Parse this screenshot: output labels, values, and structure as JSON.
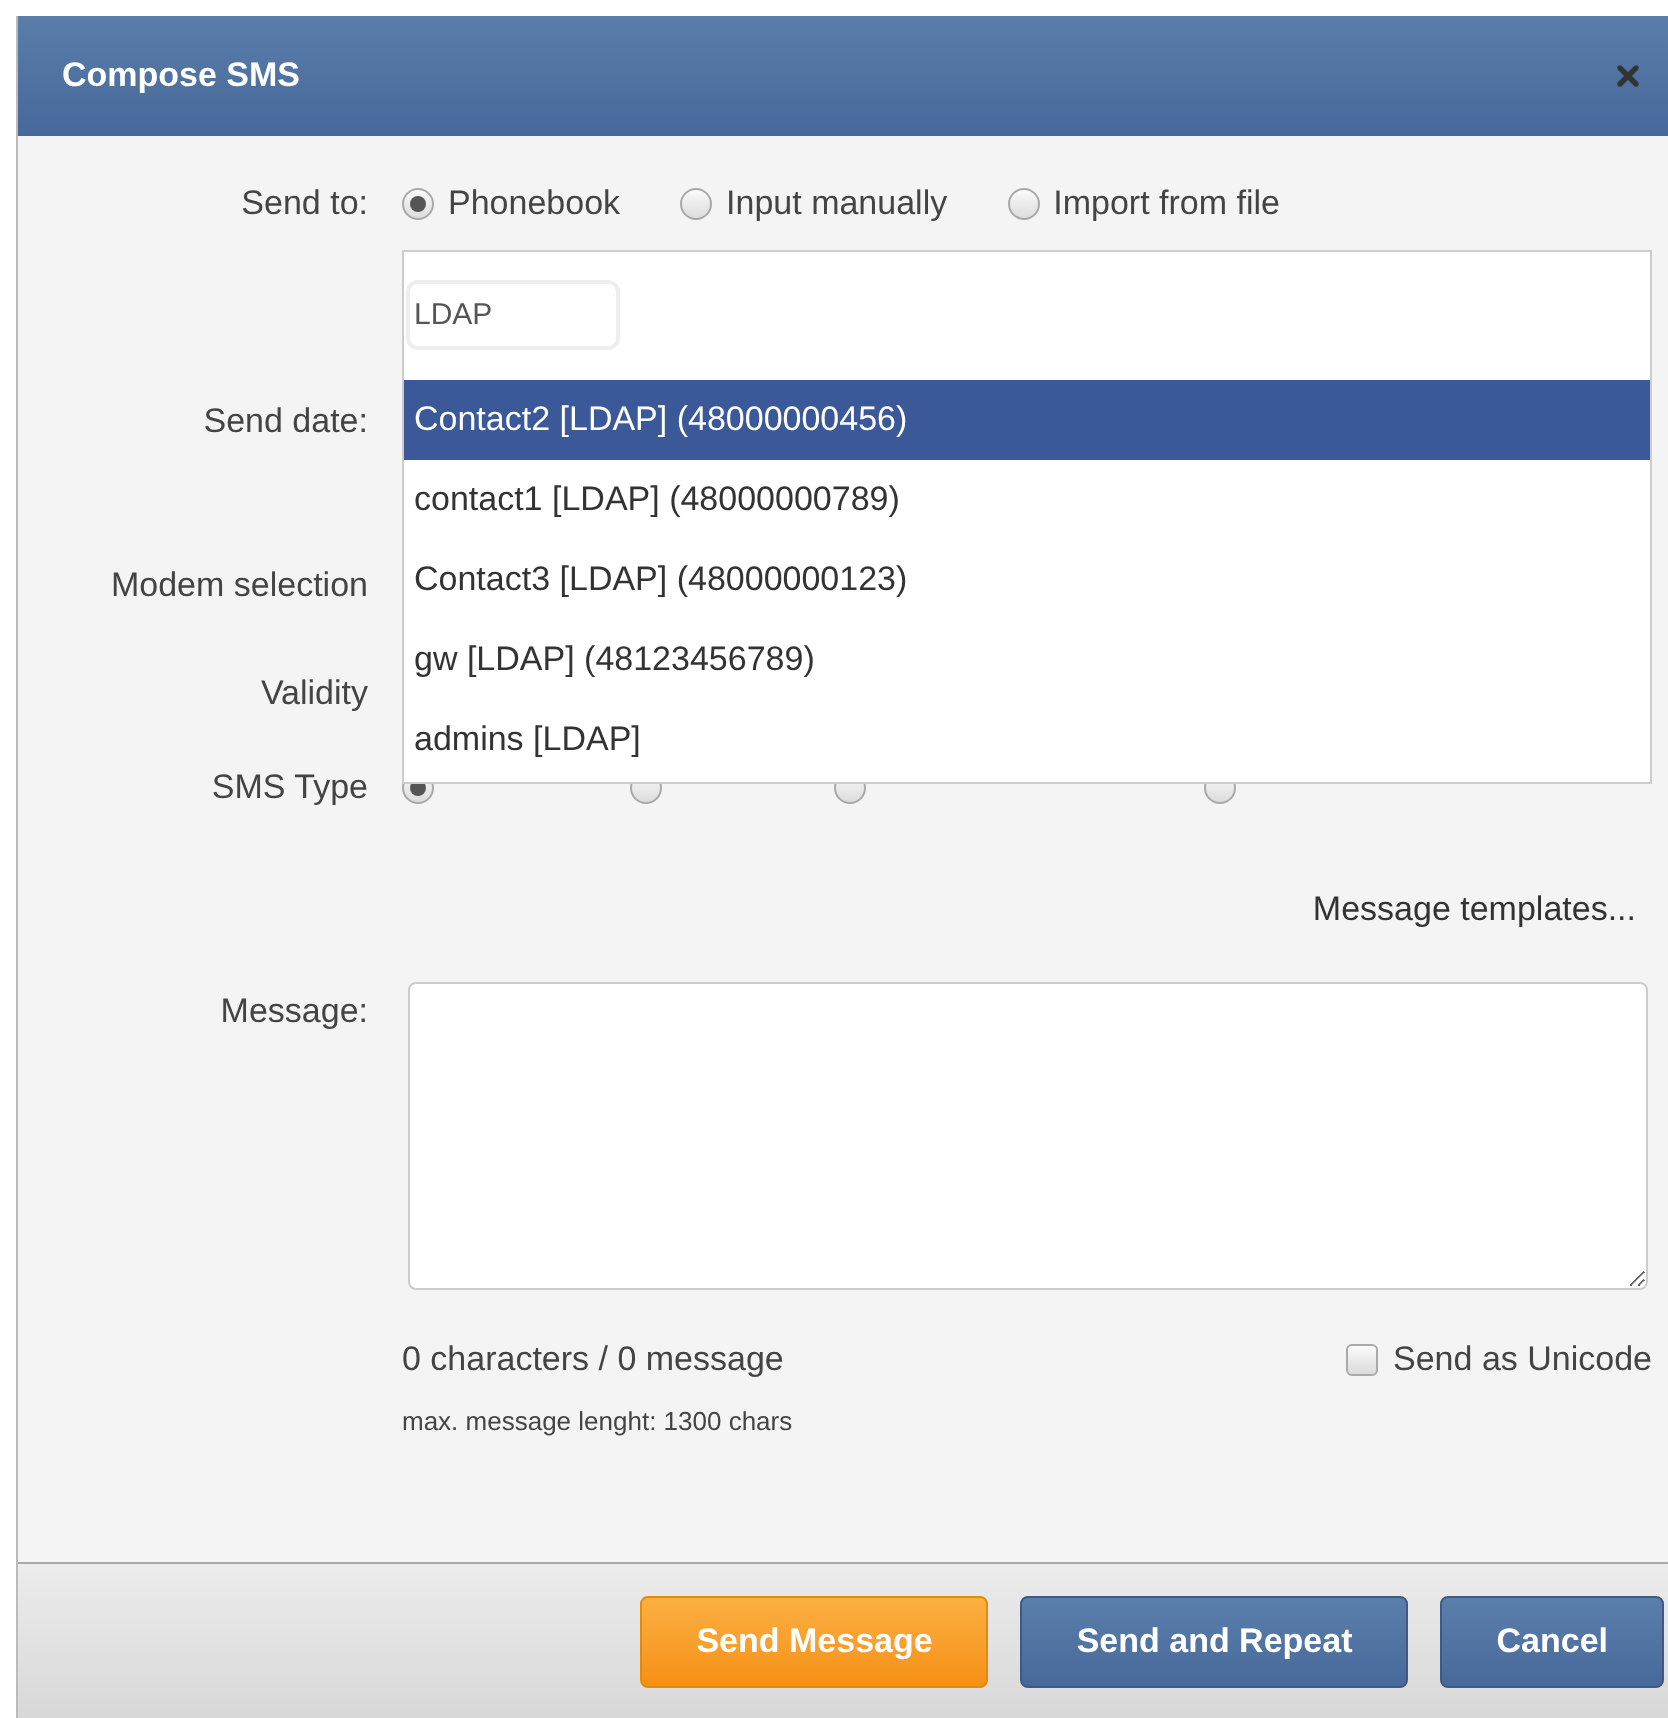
{
  "dialog": {
    "title": "Compose SMS"
  },
  "send_to": {
    "label": "Send to:",
    "options": [
      {
        "label": "Phonebook",
        "selected": true
      },
      {
        "label": "Input manually",
        "selected": false
      },
      {
        "label": "Import from file",
        "selected": false
      }
    ]
  },
  "recipient_search": {
    "value": "LDAP"
  },
  "suggestions": [
    {
      "label": "Contact2 [LDAP] (48000000456)",
      "selected": true
    },
    {
      "label": "contact1 [LDAP] (48000000789)",
      "selected": false
    },
    {
      "label": "Contact3 [LDAP] (48000000123)",
      "selected": false
    },
    {
      "label": "gw [LDAP] (48123456789)",
      "selected": false
    },
    {
      "label": "admins [LDAP]",
      "selected": false
    }
  ],
  "fields": [
    {
      "label": "Send date:"
    },
    {
      "label": "Modem selection"
    },
    {
      "label": "Validity"
    }
  ],
  "sms_type": {
    "label": "SMS Type",
    "options": [
      {
        "selected": true
      },
      {
        "selected": false
      },
      {
        "selected": false
      },
      {
        "selected": false
      }
    ]
  },
  "message_templates": "Message templates...",
  "message": {
    "label": "Message:"
  },
  "counter": "0 characters / 0 message",
  "send_as_unicode": {
    "label": "Send as Unicode",
    "checked": false
  },
  "max_length_note": "max. message lenght: 1300 chars",
  "buttons": [
    {
      "label": "Send Message",
      "kind": "primary"
    },
    {
      "label": "Send and Repeat",
      "kind": "secondary"
    },
    {
      "label": "Cancel",
      "kind": "secondary"
    }
  ]
}
